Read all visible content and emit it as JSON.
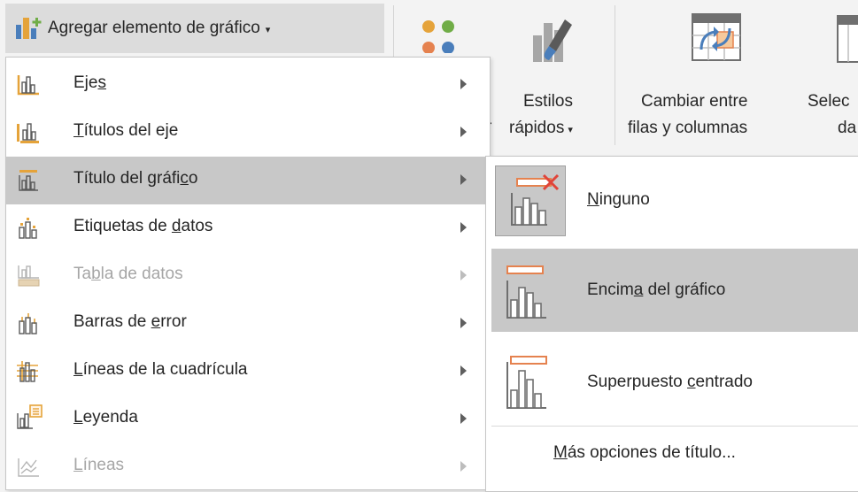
{
  "ribbon": {
    "add_element": {
      "label": "Agregar elemento de gráfico",
      "caret": "▾"
    },
    "quick_layout": {
      "partial_char": "r"
    },
    "quick_styles": {
      "line1": "Estilos",
      "line2": "rápidos",
      "caret": "▾"
    },
    "switch_row_col": {
      "line1": "Cambiar entre",
      "line2": "filas y columnas"
    },
    "select_data": {
      "line1": "Selec",
      "line2": "da"
    }
  },
  "menu": {
    "items": [
      {
        "pre": "Eje",
        "ul": "s",
        "post": "",
        "icon": "axes-icon",
        "disabled": false,
        "selected": false
      },
      {
        "pre": "",
        "ul": "T",
        "post": "ítulos del eje",
        "icon": "axis-titles-icon",
        "disabled": false,
        "selected": false
      },
      {
        "pre": "Título del gráfi",
        "ul": "c",
        "post": "o",
        "icon": "chart-title-icon",
        "disabled": false,
        "selected": true
      },
      {
        "pre": "Etiquetas de ",
        "ul": "d",
        "post": "atos",
        "icon": "data-labels-icon",
        "disabled": false,
        "selected": false
      },
      {
        "pre": "Ta",
        "ul": "b",
        "post": "la de datos",
        "icon": "data-table-icon",
        "disabled": true,
        "selected": false
      },
      {
        "pre": "Barras de ",
        "ul": "e",
        "post": "rror",
        "icon": "error-bars-icon",
        "disabled": false,
        "selected": false
      },
      {
        "pre": "",
        "ul": "L",
        "post": "íneas de la cuadrícula",
        "icon": "gridlines-icon",
        "disabled": false,
        "selected": false
      },
      {
        "pre": "",
        "ul": "L",
        "post": "eyenda",
        "icon": "legend-icon",
        "disabled": false,
        "selected": false
      },
      {
        "pre": "",
        "ul": "L",
        "post": "íneas",
        "icon": "lines-icon",
        "disabled": true,
        "selected": false
      }
    ]
  },
  "submenu": {
    "none": {
      "pre": "",
      "ul": "N",
      "post": "inguno"
    },
    "above": {
      "pre": "Encim",
      "ul": "a",
      "post": " del gráfico"
    },
    "centered": {
      "pre": "Superpuesto ",
      "ul": "c",
      "post": "entrado"
    },
    "more": {
      "pre": "",
      "ul": "M",
      "post": "ás opciones de título..."
    }
  },
  "colors": {
    "accent_orange": "#e5824f",
    "accent_blue": "#4a7ebb",
    "accent_green": "#70ad47",
    "selected_bg": "#c8c8c8",
    "red_x": "#e0443a"
  }
}
